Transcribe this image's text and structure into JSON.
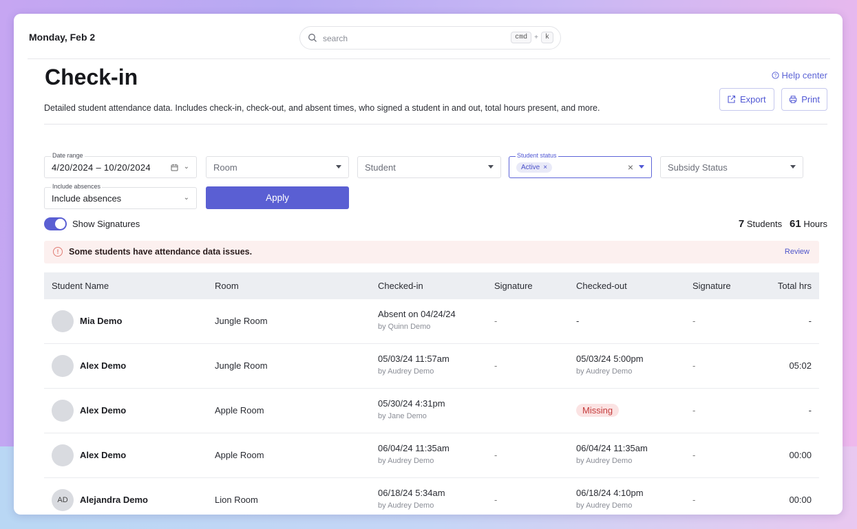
{
  "header": {
    "date": "Monday, Feb 2",
    "search_placeholder": "search",
    "shortcut_key1": "cmd",
    "shortcut_plus": "+",
    "shortcut_key2": "k"
  },
  "page": {
    "title": "Check-in",
    "help_label": "Help center",
    "description": "Detailed student attendance data. Includes check-in, check-out, and absent times, who signed a student in and out, total hours present, and more.",
    "export_label": "Export",
    "print_label": "Print"
  },
  "filters": {
    "date_range_label": "Date range",
    "date_range_value": "4/20/2024 – 10/20/2024",
    "room_placeholder": "Room",
    "student_placeholder": "Student",
    "student_status_label": "Student status",
    "student_status_chip": "Active",
    "subsidy_placeholder": "Subsidy Status",
    "absences_label": "Include absences",
    "absences_value": "Include absences",
    "apply_label": "Apply"
  },
  "summary": {
    "show_signatures_label": "Show Signatures",
    "show_signatures_on": true,
    "students_count": "7",
    "students_label": "Students",
    "hours_count": "61",
    "hours_label": "Hours"
  },
  "alert": {
    "message": "Some students have attendance data issues.",
    "action": "Review"
  },
  "table": {
    "columns": [
      "Student Name",
      "Room",
      "Checked-in",
      "Signature",
      "Checked-out",
      "Signature",
      "Total hrs"
    ],
    "rows": [
      {
        "initials": "",
        "name": "Mia Demo",
        "room": "Jungle Room",
        "checked_in": "Absent on 04/24/24",
        "checked_in_by": "by Quinn Demo",
        "sig_in": "-",
        "checked_out": "-",
        "checked_out_by": "",
        "sig_out": "-",
        "total": "-"
      },
      {
        "initials": "",
        "name": "Alex Demo",
        "room": "Jungle Room",
        "checked_in": "05/03/24 11:57am",
        "checked_in_by": "by Audrey Demo",
        "sig_in": "-",
        "checked_out": "05/03/24 5:00pm",
        "checked_out_by": "by Audrey Demo",
        "sig_out": "-",
        "total": "05:02"
      },
      {
        "initials": "",
        "name": "Alex Demo",
        "room": "Apple Room",
        "checked_in": "05/30/24 4:31pm",
        "checked_in_by": "by Jane Demo",
        "sig_in": "",
        "checked_out": "Missing",
        "checked_out_by": "",
        "sig_out": "-",
        "total": "-"
      },
      {
        "initials": "",
        "name": "Alex Demo",
        "room": "Apple Room",
        "checked_in": "06/04/24 11:35am",
        "checked_in_by": "by Audrey Demo",
        "sig_in": "-",
        "checked_out": "06/04/24 11:35am",
        "checked_out_by": "by Audrey Demo",
        "sig_out": "-",
        "total": "00:00"
      },
      {
        "initials": "AD",
        "name": "Alejandra Demo",
        "room": "Lion Room",
        "checked_in": "06/18/24 5:34am",
        "checked_in_by": "by Audrey Demo",
        "sig_in": "-",
        "checked_out": "06/18/24 4:10pm",
        "checked_out_by": "by Audrey Demo",
        "sig_out": "-",
        "total": "00:00"
      }
    ]
  },
  "colors": {
    "accent": "#5a5fd3",
    "alert_bg": "#fcf0ef",
    "missing_text": "#c43c3c",
    "missing_bg": "#fbe3e3"
  }
}
